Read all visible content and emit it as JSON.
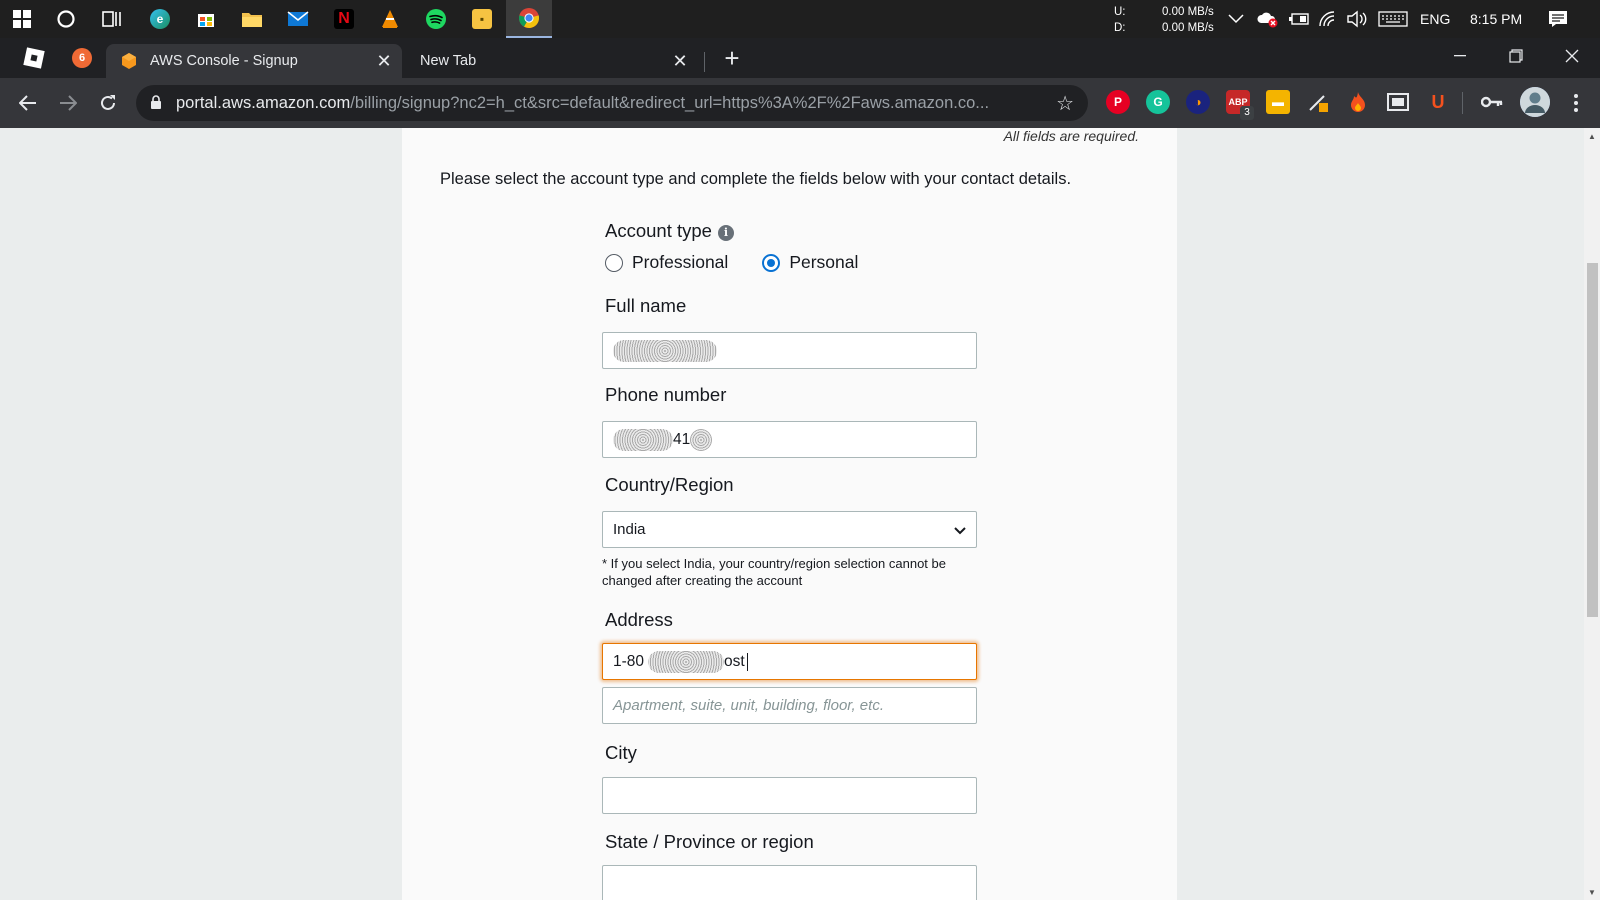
{
  "taskbar": {
    "network_up_label": "U:",
    "network_down_label": "D:",
    "network_up": "0.00 MB/s",
    "network_down": "0.00 MB/s",
    "language": "ENG",
    "time": "8:15 PM",
    "apps": [
      "windows-start-icon",
      "cortana-icon",
      "task-view-icon",
      "edge-icon",
      "store-icon",
      "file-explorer-icon",
      "mail-icon",
      "netflix-icon",
      "vlc-icon",
      "spotify-icon",
      "sticky-notes-icon",
      "chrome-icon"
    ]
  },
  "tabs": {
    "active_title": "AWS Console - Signup",
    "second_title": "New Tab",
    "new_tab_symbol": "+"
  },
  "toolbar": {
    "url_host": "portal.aws.amazon.com",
    "url_path": "/billing/signup?nc2=h_ct&src=default&redirect_url=https%3A%2F%2Faws.amazon.co...",
    "extensions_badge": "3"
  },
  "form": {
    "required_note": "All fields are required.",
    "intro": "Please select the account type and complete the fields below with your contact details.",
    "account_type_label": "Account type",
    "account_type_info": "i",
    "account_type_options": [
      {
        "label": "Professional",
        "checked": false
      },
      {
        "label": "Personal",
        "checked": true
      }
    ],
    "full_name_label": "Full name",
    "full_name_value": "",
    "phone_label": "Phone number",
    "phone_visible_fragment": "41",
    "country_label": "Country/Region",
    "country_value": "India",
    "country_hint": "* If you select India, your country/region selection cannot be changed after creating the account",
    "address_label": "Address",
    "address_prefix": "1-80",
    "address_suffix": "ost",
    "address2_placeholder": "Apartment, suite, unit, building, floor, etc.",
    "city_label": "City",
    "state_label": "State / Province or region"
  },
  "colors": {
    "radio_selected": "#0972d3",
    "focus_ring": "#e77600",
    "page_bg": "#eaeded"
  }
}
